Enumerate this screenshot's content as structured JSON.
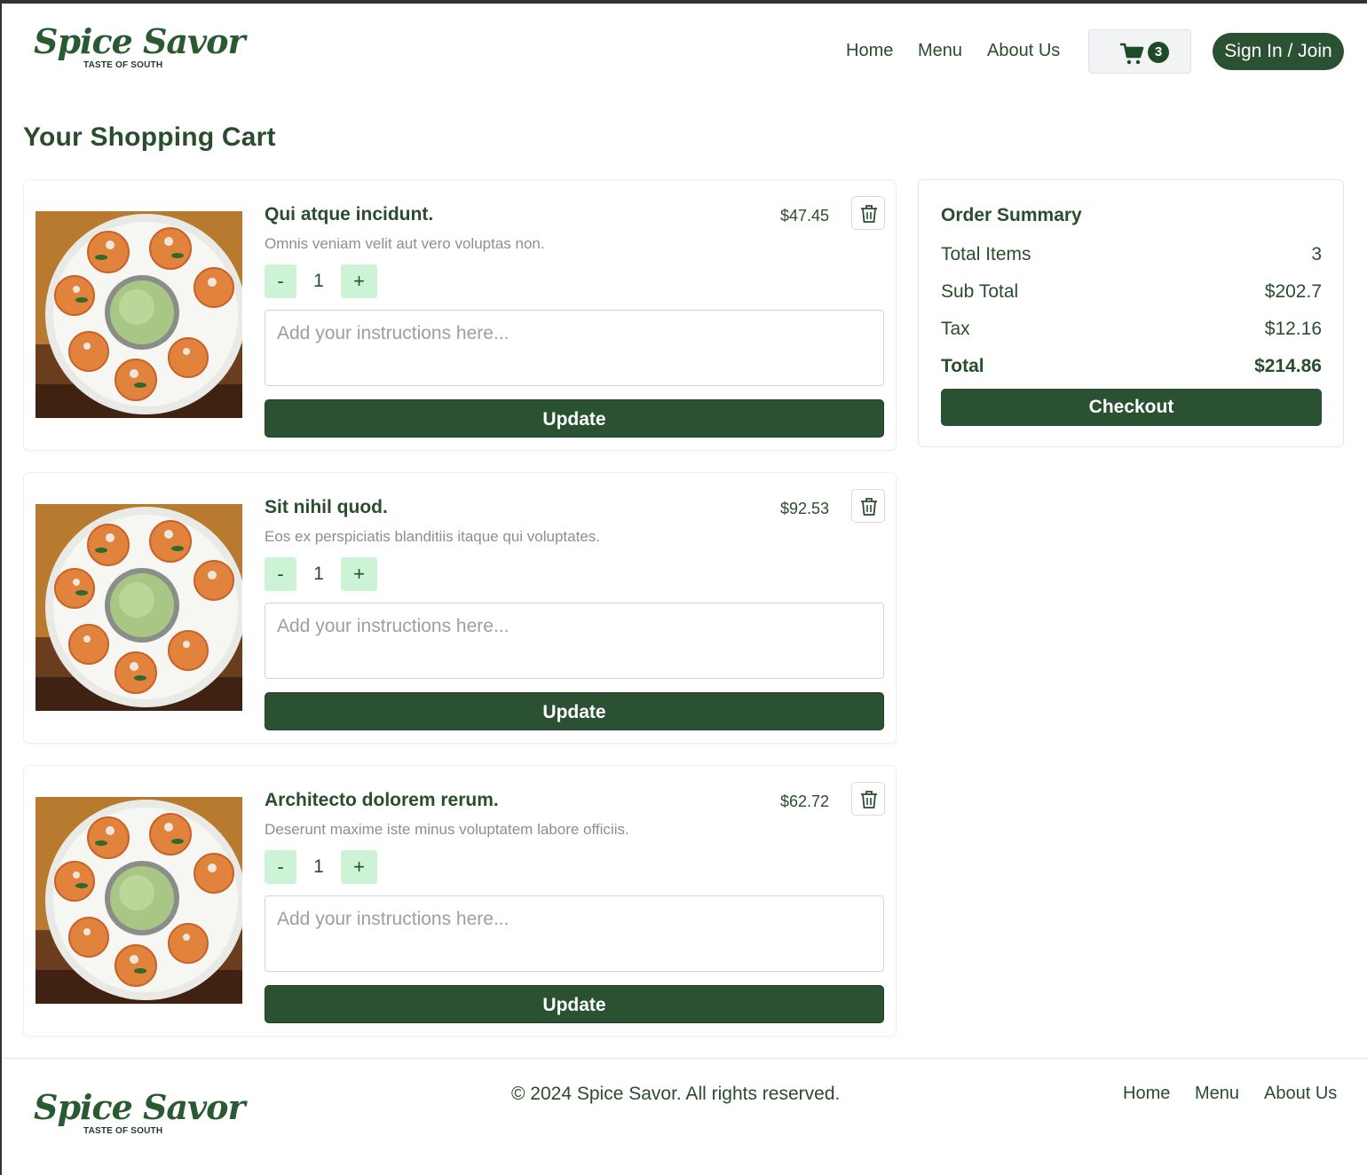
{
  "brand": {
    "name": "Spice Savor",
    "tagline": "TASTE OF SOUTH"
  },
  "nav": {
    "home": "Home",
    "menu": "Menu",
    "about": "About Us"
  },
  "cart": {
    "count": "3"
  },
  "auth": {
    "signin_label": "Sign In / Join"
  },
  "page": {
    "title": "Your Shopping Cart"
  },
  "items": [
    {
      "title": "Qui atque incidunt.",
      "description": "Omnis veniam velit aut vero voluptas non.",
      "price": "$47.45",
      "quantity": "1",
      "instructions_placeholder": "Add your instructions here...",
      "update_label": "Update",
      "minus": "-",
      "plus": "+"
    },
    {
      "title": "Sit nihil quod.",
      "description": "Eos ex perspiciatis blanditiis itaque qui voluptates.",
      "price": "$92.53",
      "quantity": "1",
      "instructions_placeholder": "Add your instructions here...",
      "update_label": "Update",
      "minus": "-",
      "plus": "+"
    },
    {
      "title": "Architecto dolorem rerum.",
      "description": "Deserunt maxime iste minus voluptatem labore officiis.",
      "price": "$62.72",
      "quantity": "1",
      "instructions_placeholder": "Add your instructions here...",
      "update_label": "Update",
      "minus": "-",
      "plus": "+"
    }
  ],
  "summary": {
    "title": "Order Summary",
    "total_items_label": "Total Items",
    "total_items_value": "3",
    "subtotal_label": "Sub Total",
    "subtotal_value": "$202.7",
    "tax_label": "Tax",
    "tax_value": "$12.16",
    "total_label": "Total",
    "total_value": "$214.86",
    "checkout_label": "Checkout"
  },
  "footer": {
    "copyright": "© 2024 Spice Savor. All rights reserved."
  },
  "colors": {
    "primary": "#2a5132",
    "text": "#2a4d2e",
    "qty_bg": "#cdf3d7",
    "muted": "#8a8f93"
  },
  "icons": {
    "cart": "cart-icon",
    "trash": "trash-icon",
    "food": "food-image"
  }
}
